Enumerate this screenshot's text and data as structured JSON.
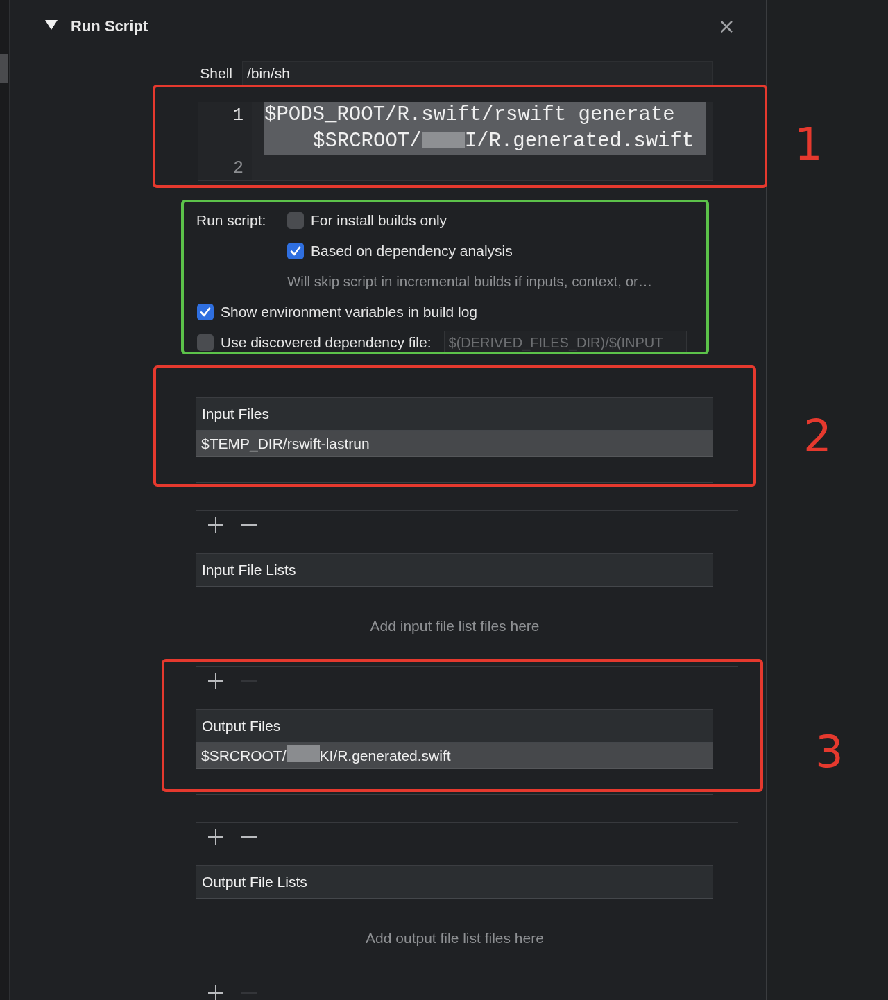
{
  "phase": {
    "title": "Run Script",
    "expanded": true,
    "close": "×"
  },
  "shell": {
    "label": "Shell",
    "value": "/bin/sh"
  },
  "script": {
    "lines": [
      {
        "number": "1",
        "parts": [
          "$PODS_ROOT/R.swift/rswift generate $SRCROOT/",
          "I/R.generated.swift"
        ],
        "selected": true
      },
      {
        "number": "2",
        "selected": false
      }
    ]
  },
  "run_script": {
    "label": "Run script:",
    "options": [
      {
        "label": "For install builds only",
        "checked": false
      },
      {
        "label": "Based on dependency analysis",
        "checked": true
      }
    ],
    "note": "Will skip script in incremental builds if inputs, context, or…"
  },
  "options": [
    {
      "label": "Show environment variables in build log",
      "checked": true
    },
    {
      "label": "Use discovered dependency file:",
      "checked": false,
      "field": {
        "placeholder": "$(DERIVED_FILES_DIR)/$(INPUT"
      }
    }
  ],
  "sections": [
    {
      "kind": "files",
      "title": "Input Files",
      "items": [
        {
          "parts": [
            "$TEMP_DIR/rswift-lastrun"
          ]
        }
      ],
      "remove_enabled": true
    },
    {
      "kind": "lists",
      "title": "Input File Lists",
      "empty_message": "Add input file list files here",
      "remove_enabled": false
    },
    {
      "kind": "files",
      "title": "Output Files",
      "items": [
        {
          "parts": [
            "$SRCROOT/",
            "KI/R.generated.swift"
          ]
        }
      ],
      "remove_enabled": true
    },
    {
      "kind": "lists",
      "title": "Output File Lists",
      "empty_message": "Add output file list files here",
      "remove_enabled": false
    }
  ],
  "annotations": [
    {
      "label": "1",
      "color": "#e5392e"
    },
    {
      "color": "#5cc24a"
    },
    {
      "label": "2",
      "color": "#e5392e"
    },
    {
      "label": "3",
      "color": "#e5392e"
    }
  ]
}
